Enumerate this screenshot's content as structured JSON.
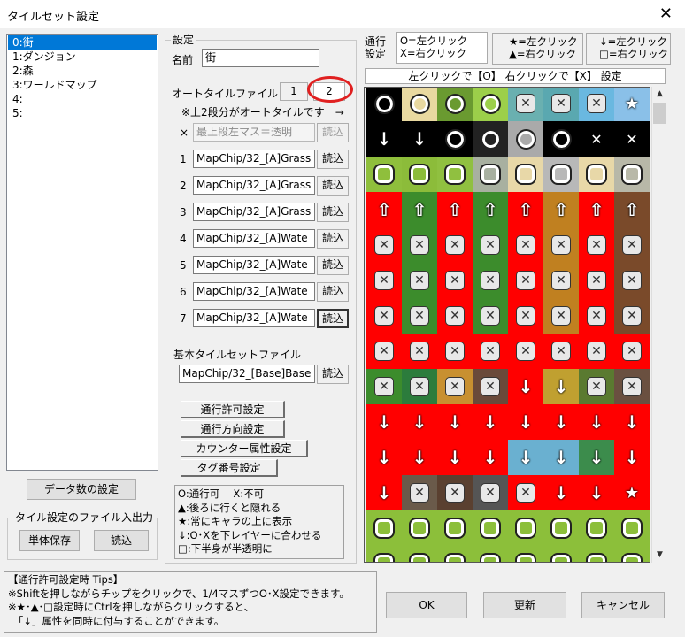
{
  "window": {
    "title": "タイルセット設定",
    "close_glyph": "✕"
  },
  "tileset_list": [
    "0:街",
    "1:ダンジョン",
    "2:森",
    "3:ワールドマップ",
    "4:",
    "5:"
  ],
  "data_count_button": "データ数の設定",
  "file_io": {
    "caption": "タイル設定のファイル入出力",
    "save_label": "単体保存",
    "load_label": "読込"
  },
  "settings": {
    "caption": "設定",
    "name_label": "名前",
    "name_value": "街",
    "autotile_label": "オートタイルファイル",
    "page1": "1",
    "page2": "2",
    "autotile_note": "※上2段分がオートタイルです　→",
    "read_label": "読込",
    "autotile_rows": [
      {
        "idx": "×",
        "value": "最上段左マス＝透明",
        "disabled": true
      },
      {
        "idx": "1",
        "value": "MapChip/32_[A]Grass"
      },
      {
        "idx": "2",
        "value": "MapChip/32_[A]Grass"
      },
      {
        "idx": "3",
        "value": "MapChip/32_[A]Grass"
      },
      {
        "idx": "4",
        "value": "MapChip/32_[A]Wate"
      },
      {
        "idx": "5",
        "value": "MapChip/32_[A]Wate"
      },
      {
        "idx": "6",
        "value": "MapChip/32_[A]Wate"
      },
      {
        "idx": "7",
        "value": "MapChip/32_[A]Wate"
      }
    ],
    "base_label": "基本タイルセットファイル",
    "base_value": "MapChip/32_[Base]Base",
    "buttons": [
      "通行許可設定",
      "通行方向設定",
      "カウンター属性設定",
      "タグ番号設定"
    ]
  },
  "legend": [
    "O:通行可　 X:不可",
    "▲:後ろに行くと隠れる",
    "★:常にキャラの上に表示",
    "↓:O･Xを下レイヤーに合わせる",
    "□:下半身が半透明に"
  ],
  "tips": [
    "【通行許可設定時 Tips】",
    "※Shiftを押しながらチップをクリックで、1/4マスずつO･X設定できます。",
    "※★･▲･□設定時にCtrlを押しながらクリックすると、",
    "　「↓」属性を同時に付与することができます。"
  ],
  "passable": {
    "set_label_1": "通行",
    "set_label_2": "設定",
    "tabs": [
      {
        "l1": "O=左クリック",
        "l2": "X=右クリック"
      },
      {
        "l1": "★=左クリック",
        "l2": "▲=右クリック"
      },
      {
        "l1": "↓=左クリック",
        "l2": "□=右クリック"
      }
    ],
    "instruction": "左クリックで【O】 右クリックで【X】 設定"
  },
  "footer": {
    "ok": "OK",
    "update": "更新",
    "cancel": "キャンセル"
  },
  "colors": {
    "accent": "#0078d7",
    "red": "#ff0000",
    "grass": "#8cbf3a"
  },
  "tile_rows": [
    [
      "o:#000",
      "o:#e9d9a0",
      "o:#6a9a30",
      "o:#9ccf4a",
      "x:#6ab0b0",
      "x:#5aa8b0",
      "x:#6ab8e0",
      "st:#8ac0e8"
    ],
    [
      "arr:#000",
      "arr:#000",
      "o:#000",
      "o:#222",
      "o:#aaa",
      "o:#000",
      "xw:#000",
      "xw:#000"
    ],
    [
      "o:#8fbf3c",
      "o:#8cbc3a",
      "o:#90c040",
      "o:#a8b0a0",
      "o:#e8d8a8",
      "o:#b8b8b8",
      "o:#e8d8a8",
      "o:#b8b8a8"
    ],
    [
      "up:#f00",
      "up:#3c8c2c",
      "up:#f00",
      "up:#3c8c2c",
      "up:#f00",
      "up:#c08020",
      "up:#f00",
      "up:#7a4a2a"
    ],
    [
      "x:#f00",
      "x:#3c8c2c",
      "x:#f00",
      "x:#3c8c2c",
      "x:#f00",
      "x:#c08020",
      "x:#f00",
      "x:#7a4a2a"
    ],
    [
      "x:#f00",
      "x:#3c8c2c",
      "x:#f00",
      "x:#3c8c2c",
      "x:#f00",
      "x:#c08020",
      "x:#f00",
      "x:#7a4a2a"
    ],
    [
      "x:#f00",
      "x:#3c8c2c",
      "x:#f00",
      "x:#3c8c2c",
      "x:#f00",
      "x:#c08020",
      "x:#f00",
      "x:#7a4a2a"
    ],
    [
      "x:#f00",
      "x:#f00",
      "x:#f00",
      "x:#f00",
      "x:#f00",
      "x:#f00",
      "x:#f00",
      "x:#f00"
    ],
    [
      "x:#3c8c2c",
      "x:#2c7c3c",
      "x:#c89030",
      "x:#6a4a3a",
      "arr:#f00",
      "arr:#c0a030",
      "x:#5a7a30",
      "x:#6a5040"
    ],
    [
      "arr:#f00",
      "arr:#f00",
      "arr:#f00",
      "arr:#f00",
      "arr:#f00",
      "arr:#f00",
      "arr:#f00",
      "arr:#f00"
    ],
    [
      "arr:#f00",
      "arr:#f00",
      "arr:#f00",
      "arr:#f00",
      "arr:#6ab0d0",
      "arr:#6ab0d0",
      "arr:#3c8c4c",
      "arr:#f00"
    ],
    [
      "arr:#f00",
      "x:#6a5a4a",
      "x:#5a4030",
      "x:#555",
      "x:#f00",
      "arr:#f00",
      "arr:#f00",
      "st:#f00"
    ],
    [
      "o:#8cbf3a",
      "o:#8cbf3a",
      "o:#8cbf3a",
      "o:#8cbf3a",
      "o:#8cbf3a",
      "o:#8cbf3a",
      "o:#8cbf3a",
      "o:#8cbf3a"
    ],
    [
      "o:#8cbf3a",
      "o:#8cbf3a",
      "o:#8cbf3a",
      "o:#8cbf3a",
      "o:#8cbf3a",
      "o:#8cbf3a",
      "o:#8cbf3a",
      "o:#8cbf3a"
    ],
    [
      "o:#8cbf3a",
      "o:#8cbf3a",
      "o:#8cbf3a",
      "o:#8cbf3a",
      "o:#f00",
      "o:#8cbf3a",
      "o:#8cbf3a",
      "o:#8cbf3a"
    ]
  ]
}
